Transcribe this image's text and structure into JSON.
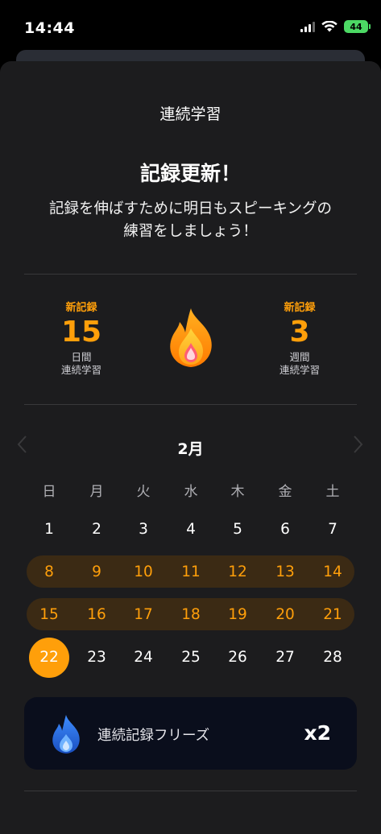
{
  "status_bar": {
    "time": "14:44",
    "battery": "44"
  },
  "sheet": {
    "title": "連続学習",
    "headline": "記録更新！",
    "subtext": "記録を伸ばすために明日もスピーキングの練習をしましょう！"
  },
  "stats": {
    "left": {
      "badge": "新記録",
      "number": "15",
      "label_line1": "日間",
      "label_line2": "連続学習"
    },
    "right": {
      "badge": "新記録",
      "number": "3",
      "label_line1": "週間",
      "label_line2": "連続学習"
    },
    "center_icon": "flame-icon"
  },
  "calendar": {
    "month": "2月",
    "prev_icon": "chevron-left-icon",
    "next_icon": "chevron-right-icon",
    "weekdays": [
      "日",
      "月",
      "火",
      "水",
      "木",
      "金",
      "土"
    ],
    "weeks": [
      [
        "1",
        "2",
        "3",
        "4",
        "5",
        "6",
        "7"
      ],
      [
        "8",
        "9",
        "10",
        "11",
        "12",
        "13",
        "14"
      ],
      [
        "15",
        "16",
        "17",
        "18",
        "19",
        "20",
        "21"
      ],
      [
        "22",
        "23",
        "24",
        "25",
        "26",
        "27",
        "28"
      ]
    ],
    "streak_weeks": [
      1,
      2
    ],
    "today": "22"
  },
  "freeze": {
    "icon": "ice-flame-icon",
    "label": "連続記録フリーズ",
    "count": "x2"
  },
  "colors": {
    "accent": "#ff9f0a",
    "sheet_bg": "#1c1c1e",
    "streak_band": "#3b2a14",
    "freeze_card": "#0a0e1c"
  }
}
